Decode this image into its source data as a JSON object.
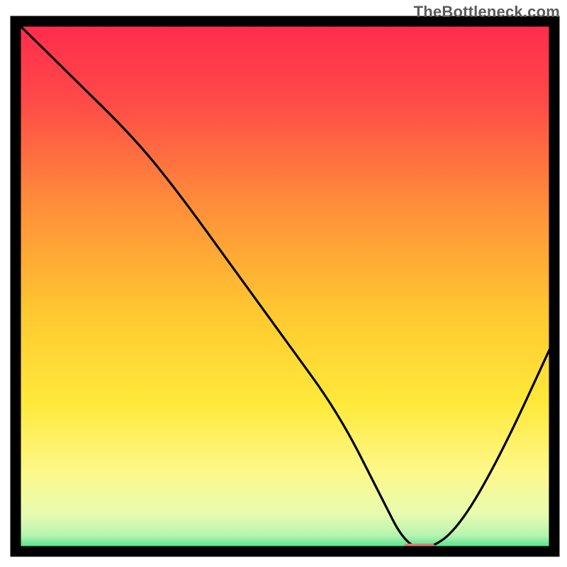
{
  "watermark": "TheBottleneck.com",
  "chart_data": {
    "type": "line",
    "title": "",
    "xlabel": "",
    "ylabel": "",
    "xlim": [
      0,
      100
    ],
    "ylim": [
      0,
      100
    ],
    "grid": false,
    "legend": false,
    "background_gradient": {
      "stops": [
        {
          "offset": 0.0,
          "color": "#ff2a4d"
        },
        {
          "offset": 0.15,
          "color": "#ff4a48"
        },
        {
          "offset": 0.35,
          "color": "#ff8f3a"
        },
        {
          "offset": 0.55,
          "color": "#ffc830"
        },
        {
          "offset": 0.72,
          "color": "#ffe93a"
        },
        {
          "offset": 0.85,
          "color": "#fdf88a"
        },
        {
          "offset": 0.93,
          "color": "#e8fbb0"
        },
        {
          "offset": 0.97,
          "color": "#b6f4b0"
        },
        {
          "offset": 1.0,
          "color": "#2bdc7b"
        }
      ]
    },
    "curve": {
      "comment": "Bottleneck % (y) vs component match position (x). High = bad (red), 0 = optimal (green). Curve dips to a flat minimum then rises.",
      "x": [
        0,
        10,
        22,
        30,
        40,
        50,
        60,
        68,
        72,
        76,
        82,
        90,
        100
      ],
      "y": [
        100,
        90,
        78,
        68,
        54,
        40,
        26,
        10,
        2,
        0,
        4,
        18,
        40
      ]
    },
    "optimal_marker": {
      "x_start": 72,
      "x_end": 78,
      "color": "#e07a78"
    },
    "frame_color": "#000000"
  }
}
